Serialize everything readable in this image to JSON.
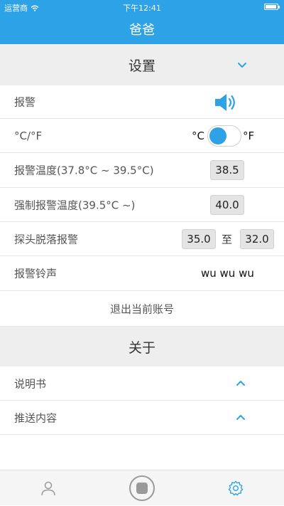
{
  "status_bar": {
    "carrier": "运营商",
    "time": "下午12:41",
    "wifi_icon": "wifi-icon",
    "battery_level": 0.95
  },
  "nav": {
    "title": "爸爸"
  },
  "settings_section": {
    "title": "设置",
    "toggle_icon": "chevron-down-icon",
    "rows": {
      "alarm": {
        "label": "报警",
        "icon": "speaker-icon"
      },
      "unit": {
        "label": "°C/°F",
        "left_unit": "°C",
        "right_unit": "°F",
        "selected": "°C"
      },
      "alarm_temp": {
        "label": "报警温度(37.8°C ~ 39.5°C)",
        "value": "38.5"
      },
      "force_alarm_temp": {
        "label": "强制报警温度(39.5°C ~)",
        "value": "40.0"
      },
      "probe_off": {
        "label": "探头脱落报警",
        "from": "35.0",
        "to_word": "至",
        "to": "32.0"
      },
      "ringtone": {
        "label": "报警铃声",
        "value": "wu wu wu"
      },
      "logout": {
        "label": "退出当前账号"
      }
    }
  },
  "about_section": {
    "title": "关于",
    "items": [
      {
        "label": "说明书",
        "icon": "chevron-up-icon"
      },
      {
        "label": "推送内容",
        "icon": "chevron-up-icon"
      }
    ]
  },
  "bottom_tabs": {
    "items": [
      {
        "icon": "person-icon",
        "active": false
      },
      {
        "icon": "record-button-icon",
        "active": false
      },
      {
        "icon": "gear-icon",
        "active": true
      }
    ]
  },
  "colors": {
    "accent": "#2ea2e6",
    "section_bg": "#eeeeee"
  }
}
